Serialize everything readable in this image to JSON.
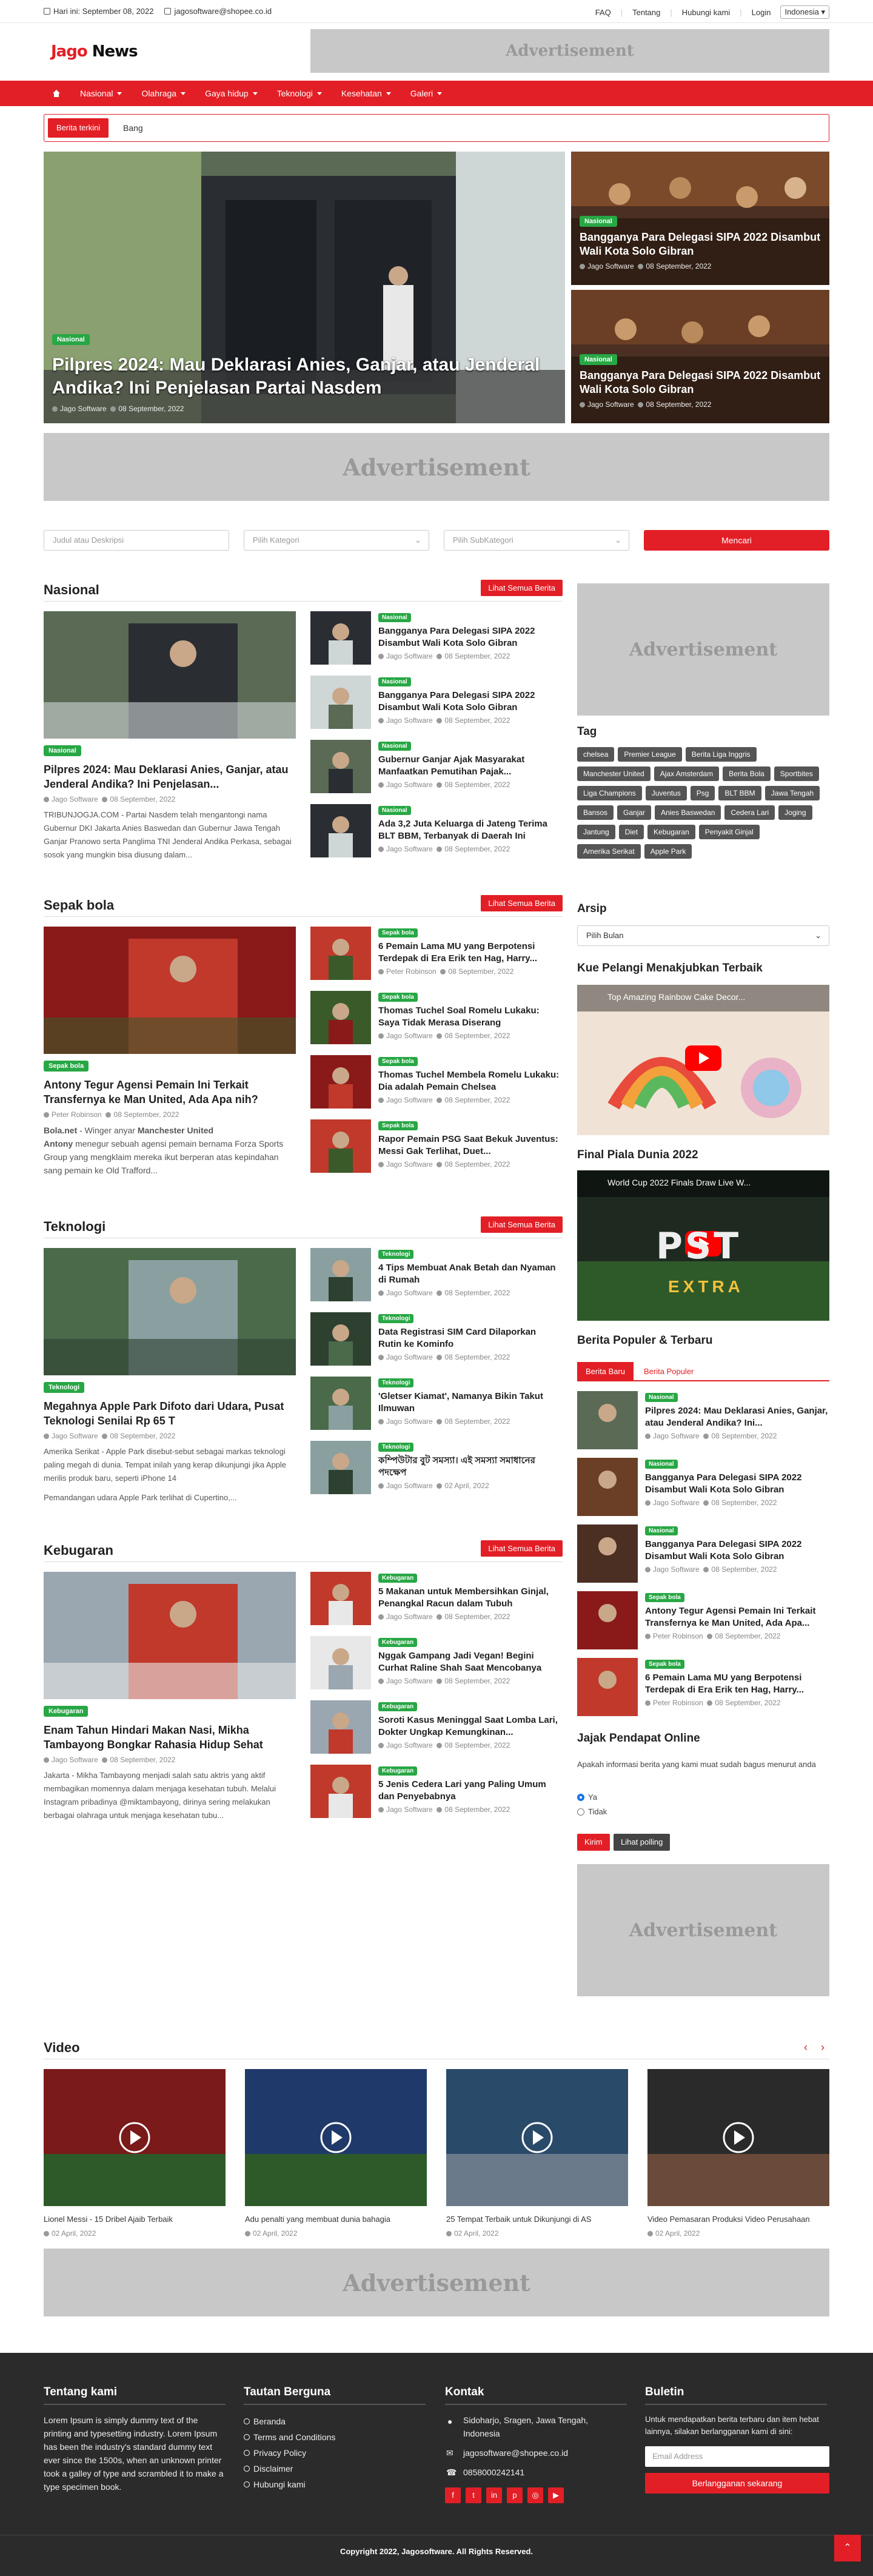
{
  "topbar": {
    "date": "Hari ini: September 08, 2022",
    "email": "jagosoftware@shopee.co.id",
    "links": [
      "FAQ",
      "Tentang",
      "Hubungi kami",
      "Login"
    ],
    "lang": "Indonesia"
  },
  "logo": {
    "a": "Jago",
    "b": " News"
  },
  "ad_text": "Advertisement",
  "nav": [
    "Nasional",
    "Olahraga",
    "Gaya hidup",
    "Teknologi",
    "Kesehatan",
    "Galeri"
  ],
  "ticker": {
    "label": "Berita terkini",
    "text": "Bang"
  },
  "hero": {
    "main": {
      "badge": "Nasional",
      "title": "Pilpres 2024: Mau Deklarasi Anies, Ganjar, atau Jenderal Andika? Ini Penjelasan Partai Nasdem",
      "author": "Jago Software",
      "date": "08 September, 2022"
    },
    "side": [
      {
        "badge": "Nasional",
        "title": "Bangganya Para Delegasi SIPA 2022 Disambut Wali Kota Solo Gibran",
        "author": "Jago Software",
        "date": "08 September, 2022"
      },
      {
        "badge": "Nasional",
        "title": "Bangganya Para Delegasi SIPA 2022 Disambut Wali Kota Solo Gibran",
        "author": "Jago Software",
        "date": "08 September, 2022"
      }
    ]
  },
  "search": {
    "placeholder": "Judul atau Deskripsi",
    "cat": "Pilih Kategori",
    "subcat": "Pilih SubKategori",
    "btn": "Mencari"
  },
  "see_all": "Lihat Semua Berita",
  "sections": [
    {
      "title": "Nasional",
      "main": {
        "badge": "Nasional",
        "title": "Pilpres 2024: Mau Deklarasi Anies, Ganjar, atau Jenderal Andika? Ini Penjelasan...",
        "author": "Jago Software",
        "date": "08 September, 2022",
        "excerpt": "TRIBUNJOGJA.COM - Partai Nasdem telah mengantongi nama Gubernur DKI Jakarta Anies Baswedan dan Gubernur Jawa Tengah Ganjar Pranowo serta Panglima TNI Jenderal Andika Perkasa, sebagai sosok yang mungkin bisa diusung dalam..."
      },
      "list": [
        {
          "badge": "Nasional",
          "title": "Bangganya Para Delegasi SIPA 2022 Disambut Wali Kota Solo Gibran",
          "author": "Jago Software",
          "date": "08 September, 2022"
        },
        {
          "badge": "Nasional",
          "title": "Bangganya Para Delegasi SIPA 2022 Disambut Wali Kota Solo Gibran",
          "author": "Jago Software",
          "date": "08 September, 2022"
        },
        {
          "badge": "Nasional",
          "title": "Gubernur Ganjar Ajak Masyarakat Manfaatkan Pemutihan Pajak...",
          "author": "Jago Software",
          "date": "08 September, 2022"
        },
        {
          "badge": "Nasional",
          "title": "Ada 3,2 Juta Keluarga di Jateng Terima BLT BBM, Terbanyak di Daerah Ini",
          "author": "Jago Software",
          "date": "08 September, 2022"
        }
      ]
    },
    {
      "title": "Sepak bola",
      "main": {
        "badge": "Sepak bola",
        "title": "Antony Tegur Agensi Pemain Ini Terkait Transfernya ke Man United, Ada Apa nih?",
        "author": "Peter Robinson",
        "date": "08 September, 2022",
        "excerpt_a": "Bola.net",
        "excerpt_b": " - Winger anyar ",
        "excerpt_c": "Manchester United",
        "excerpt_d": "Antony",
        "excerpt_e": " menegur sebuah agensi pemain bernama Forza Sports Group yang mengklaim mereka ikut berperan atas kepindahan sang pemain ke Old Trafford..."
      },
      "list": [
        {
          "badge": "Sepak bola",
          "title": "6 Pemain Lama MU yang Berpotensi Terdepak di Era Erik ten Hag, Harry...",
          "author": "Peter Robinson",
          "date": "08 September, 2022"
        },
        {
          "badge": "Sepak bola",
          "title": "Thomas Tuchel Soal Romelu Lukaku: Saya Tidak Merasa Diserang",
          "author": "Jago Software",
          "date": "08 September, 2022"
        },
        {
          "badge": "Sepak bola",
          "title": "Thomas Tuchel Membela Romelu Lukaku: Dia adalah Pemain Chelsea",
          "author": "Jago Software",
          "date": "08 September, 2022"
        },
        {
          "badge": "Sepak bola",
          "title": "Rapor Pemain PSG Saat Bekuk Juventus: Messi Gak Terlihat, Duet...",
          "author": "Jago Software",
          "date": "08 September, 2022"
        }
      ]
    },
    {
      "title": "Teknologi",
      "main": {
        "badge": "Teknologi",
        "title": "Megahnya Apple Park Difoto dari Udara, Pusat Teknologi Senilai Rp 65 T",
        "author": "Jago Software",
        "date": "08 September, 2022",
        "excerpt": "Amerika Serikat - Apple Park disebut-sebut sebagai markas teknologi paling megah di dunia. Tempat inilah yang kerap dikunjungi jika Apple merilis produk baru, seperti iPhone 14",
        "excerpt2": "Pemandangan udara Apple Park terlihat di Cupertino,..."
      },
      "list": [
        {
          "badge": "Teknologi",
          "title": "4 Tips Membuat Anak Betah dan Nyaman di Rumah",
          "author": "Jago Software",
          "date": "08 September, 2022"
        },
        {
          "badge": "Teknologi",
          "title": "Data Registrasi SIM Card Dilaporkan Rutin ke Kominfo",
          "author": "Jago Software",
          "date": "08 September, 2022"
        },
        {
          "badge": "Teknologi",
          "title": "'Gletser Kiamat', Namanya Bikin Takut Ilmuwan",
          "author": "Jago Software",
          "date": "08 September, 2022"
        },
        {
          "badge": "Teknologi",
          "title": "কম্পিউটার বুট সমস্যা। এই সমস্যা সমাধানের পদক্ষেপ",
          "author": "Jago Software",
          "date": "02 April, 2022"
        }
      ]
    },
    {
      "title": "Kebugaran",
      "main": {
        "badge": "Kebugaran",
        "title": "Enam Tahun Hindari Makan Nasi, Mikha Tambayong Bongkar Rahasia Hidup Sehat",
        "author": "Jago Software",
        "date": "08 September, 2022",
        "excerpt": "Jakarta - Mikha Tambayong menjadi salah satu aktris yang aktif membagikan momennya dalam menjaga kesehatan tubuh. Melalui Instagram pribadinya @miktambayong, dirinya sering melakukan berbagai olahraga untuk menjaga kesehatan tubu..."
      },
      "list": [
        {
          "badge": "Kebugaran",
          "title": "5 Makanan untuk Membersihkan Ginjal, Penangkal Racun dalam Tubuh",
          "author": "Jago Software",
          "date": "08 September, 2022"
        },
        {
          "badge": "Kebugaran",
          "title": "Nggak Gampang Jadi Vegan! Begini Curhat Raline Shah Saat Mencobanya",
          "author": "Jago Software",
          "date": "08 September, 2022"
        },
        {
          "badge": "Kebugaran",
          "title": "Soroti Kasus Meninggal Saat Lomba Lari, Dokter Ungkap Kemungkinan...",
          "author": "Jago Software",
          "date": "08 September, 2022"
        },
        {
          "badge": "Kebugaran",
          "title": "5 Jenis Cedera Lari yang Paling Umum dan Penyebabnya",
          "author": "Jago Software",
          "date": "08 September, 2022"
        }
      ]
    }
  ],
  "sidebar": {
    "tag_title": "Tag",
    "tags": [
      "chelsea",
      "Premier League",
      "Berita Liga Inggris",
      "Manchester United",
      "Ajax Amsterdam",
      "Berita Bola",
      "Sportbites",
      "Liga Champions",
      "Juventus",
      "Psg",
      "BLT BBM",
      "Jawa Tengah",
      "Bansos",
      "Ganjar",
      "Anies Baswedan",
      "Cedera Lari",
      "Joging",
      "Jantung",
      "Diet",
      "Kebugaran",
      "Penyakit Ginjal",
      "Amerika Serikat",
      "Apple Park"
    ],
    "archive_title": "Arsip",
    "archive_select": "Pilih Bulan",
    "video1_title": "Kue Pelangi Menakjubkan Terbaik",
    "video1_caption": "Top Amazing Rainbow Cake Decor...",
    "video2_title": "Final Piala Dunia 2022",
    "video2_caption": "World Cup 2022 Finals Draw Live W...",
    "video2_logo": "PST",
    "video2_sub": "EXTRA",
    "popular_title": "Berita Populer & Terbaru",
    "tabs": [
      "Berita Baru",
      "Berita Populer"
    ],
    "popular": [
      {
        "badge": "Nasional",
        "title": "Pilpres 2024: Mau Deklarasi Anies, Ganjar, atau Jenderal Andika? Ini...",
        "author": "Jago Software",
        "date": "08 September, 2022"
      },
      {
        "badge": "Nasional",
        "title": "Bangganya Para Delegasi SIPA 2022 Disambut Wali Kota Solo Gibran",
        "author": "Jago Software",
        "date": "08 September, 2022"
      },
      {
        "badge": "Nasional",
        "title": "Bangganya Para Delegasi SIPA 2022 Disambut Wali Kota Solo Gibran",
        "author": "Jago Software",
        "date": "08 September, 2022"
      },
      {
        "badge": "Sepak bola",
        "title": "Antony Tegur Agensi Pemain Ini Terkait Transfernya ke Man United, Ada Apa...",
        "author": "Peter Robinson",
        "date": "08 September, 2022"
      },
      {
        "badge": "Sepak bola",
        "title": "6 Pemain Lama MU yang Berpotensi Terdepak di Era Erik ten Hag, Harry...",
        "author": "Peter Robinson",
        "date": "08 September, 2022"
      }
    ],
    "poll_title": "Jajak Pendapat Online",
    "poll_q": "Apakah informasi berita yang kami muat sudah bagus menurut anda",
    "poll_opts": [
      "Ya",
      "Tidak"
    ],
    "poll_send": "Kirim",
    "poll_view": "Lihat polling"
  },
  "video_section": {
    "title": "Video",
    "items": [
      {
        "title": "Lionel Messi - 15 Dribel Ajaib Terbaik",
        "date": "02 April, 2022"
      },
      {
        "title": "Adu penalti yang membuat dunia bahagia",
        "date": "02 April, 2022"
      },
      {
        "title": "25 Tempat Terbaik untuk Dikunjungi di AS",
        "date": "02 April, 2022"
      },
      {
        "title": "Video Pemasaran Produksi Video Perusahaan",
        "date": "02 April, 2022"
      }
    ]
  },
  "footer": {
    "about_title": "Tentang kami",
    "about": "Lorem Ipsum is simply dummy text of the printing and typesetting industry. Lorem Ipsum has been the industry's standard dummy text ever since the 1500s, when an unknown printer took a galley of type and scrambled it to make a type specimen book.",
    "links_title": "Tautan Berguna",
    "links": [
      "Beranda",
      "Terms and Conditions",
      "Privacy Policy",
      "Disclaimer",
      "Hubungi kami"
    ],
    "contact_title": "Kontak",
    "address": "Sidoharjo, Sragen, Jawa Tengah, Indonesia",
    "email": "jagosoftware@shopee.co.id",
    "phone": "0858000242141",
    "social": [
      "f",
      "t",
      "in",
      "p",
      "◎",
      "▶"
    ],
    "news_title": "Buletin",
    "news_text": "Untuk mendapatkan berita terbaru dan item hebat lainnya, silakan berlangganan kami di sini:",
    "news_placeholder": "Email Address",
    "news_btn": "Berlangganan sekarang",
    "copyright": "Copyright 2022, Jagosoftware. All Rights Reserved."
  },
  "colors": {
    "accent": "#e21f26",
    "badge": "#28a745",
    "footer": "#2b2b2b"
  }
}
